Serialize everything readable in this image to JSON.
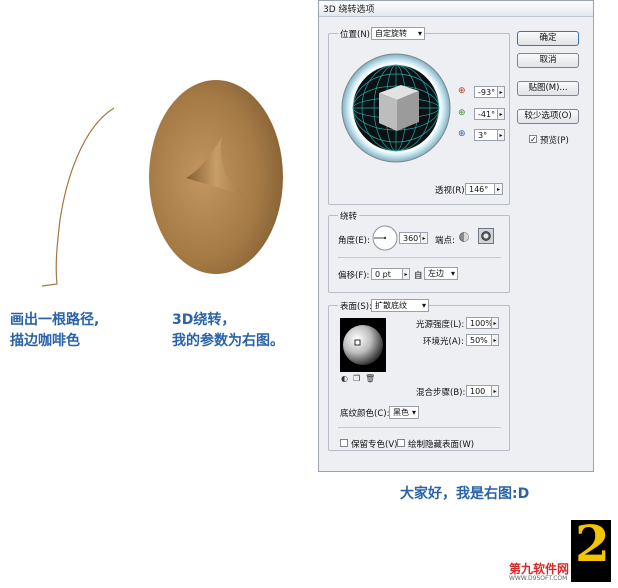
{
  "left_captions": {
    "path_caption": [
      "画出一根路径,",
      "描边咖啡色"
    ],
    "rotate_caption": [
      "3D绕转，",
      "我的参数为右图。"
    ]
  },
  "colors": {
    "caption_blue": "#2a63a8",
    "coffee": "#a57a45",
    "stroke_brown": "#a07840",
    "teal_grid": "#2bb6b1"
  },
  "dialog": {
    "title": "3D 绕转选项",
    "buttons": {
      "ok": "确定",
      "cancel": "取消",
      "map": "贴图(M)...",
      "fewer_options": "较少选项(O)"
    },
    "preview": {
      "label": "预览(P)",
      "checked": true,
      "mark": "✓"
    },
    "position": {
      "label": "位置(N):",
      "value": "自定旋转",
      "x_icon": "rotate-x-icon",
      "x_value": "-93°",
      "y_icon": "rotate-y-icon",
      "y_value": "-41°",
      "z_icon": "rotate-z-icon",
      "z_value": "3°",
      "perspective_label": "透视(R):",
      "perspective_value": "146°"
    },
    "revolve": {
      "group_label": "绕转",
      "angle_label": "角度(E):",
      "angle_value": "360°",
      "cap_label": "端点:",
      "offset_label": "偏移(F):",
      "offset_value": "0 pt",
      "from_label": "自",
      "from_value": "左边"
    },
    "surface": {
      "label": "表面(S):",
      "value": "扩散底纹",
      "light_intensity_label": "光源强度(L):",
      "light_intensity_value": "100%",
      "ambient_label": "环境光(A):",
      "ambient_value": "50%",
      "blend_steps_label": "混合步骤(B):",
      "blend_steps_value": "100",
      "shading_color_label": "底纹颜色(C):",
      "shading_color_value": "黑色",
      "preserve_spot_label": "保留专色(V)",
      "draw_hidden_label": "绘制隐藏表面(W)"
    }
  },
  "bottom_caption": "大家好，我是右图:D",
  "watermark": {
    "brand": "第九软件网",
    "url": "WWW.D9SOFT.COM",
    "number": "2"
  }
}
